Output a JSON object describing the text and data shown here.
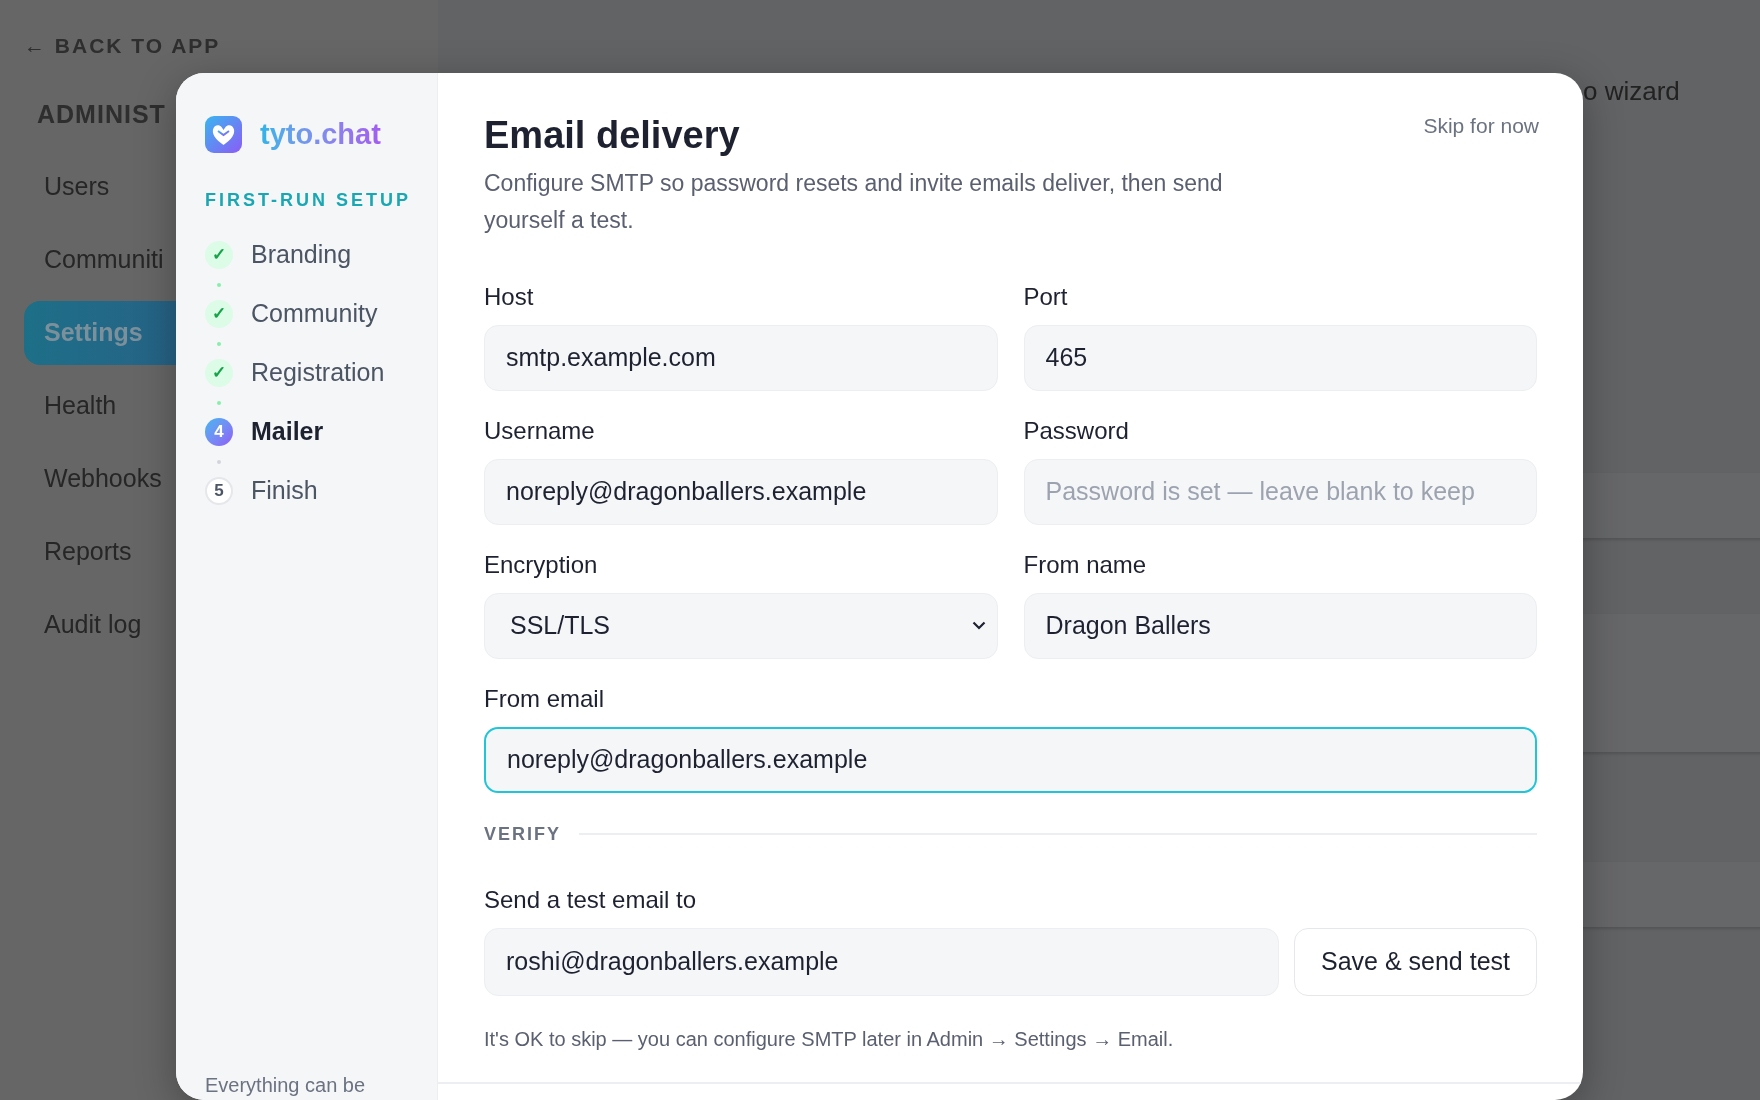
{
  "background": {
    "back_link": "← BACK TO APP",
    "section_heading": "ADMINIST",
    "nav": [
      {
        "label": "Users",
        "selected": false
      },
      {
        "label": "Communiti",
        "selected": false
      },
      {
        "label": "Settings",
        "selected": true
      },
      {
        "label": "Health",
        "selected": false
      },
      {
        "label": "Webhooks",
        "selected": false
      },
      {
        "label": "Reports",
        "selected": false
      },
      {
        "label": "Audit log",
        "selected": false
      }
    ],
    "header_link": "o wizard"
  },
  "wizard": {
    "brand": "tyto.chat",
    "setup_label": "FIRST-RUN SETUP",
    "steps": [
      {
        "marker": "✓",
        "label": "Branding",
        "completed": true,
        "selected": false
      },
      {
        "marker": "✓",
        "label": "Community",
        "completed": true,
        "selected": false
      },
      {
        "marker": "✓",
        "label": "Registration",
        "completed": true,
        "selected": false
      },
      {
        "marker": "4",
        "label": "Mailer",
        "completed": false,
        "selected": true
      },
      {
        "marker": "5",
        "label": "Finish",
        "completed": false,
        "selected": false
      }
    ],
    "footer_note": "Everything can be"
  },
  "main": {
    "title": "Email delivery",
    "subtitle": "Configure SMTP so password resets and invite emails deliver, then send yourself a test.",
    "skip_link": "Skip for now",
    "fields": [
      {
        "label": "Host",
        "kind": "text",
        "value": "smtp.example.com",
        "focused": false
      },
      {
        "label": "Port",
        "kind": "text",
        "value": "465",
        "focused": false
      },
      {
        "label": "Username",
        "kind": "text",
        "value": "noreply@dragonballers.example",
        "focused": false
      },
      {
        "label": "Password",
        "kind": "text",
        "placeholder": "Password is set — leave blank to keep",
        "focused": false
      },
      {
        "label": "Encryption",
        "kind": "select",
        "value": "SSL/TLS",
        "focused": false
      },
      {
        "label": "From name",
        "kind": "text",
        "value": "Dragon Ballers",
        "focused": false
      },
      {
        "label": "From email",
        "kind": "text",
        "value": "noreply@dragonballers.example",
        "focused": true
      }
    ],
    "verify": {
      "section_label": "VERIFY",
      "test_label": "Send a test email to",
      "test_value": "roshi@dragonballers.example",
      "button": "Save & send test",
      "note": "It's OK to skip — you can configure SMTP later in Admin → Settings → Email."
    }
  }
}
